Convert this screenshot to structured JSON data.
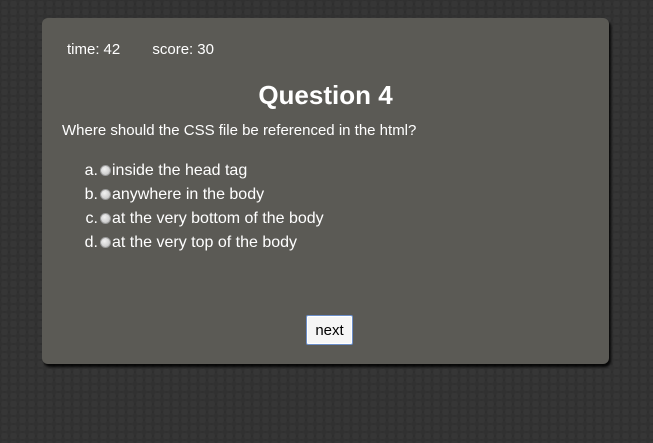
{
  "stats": {
    "time_label": "time:",
    "time_value": "42",
    "score_label": "score:",
    "score_value": "30"
  },
  "quiz": {
    "title": "Question 4",
    "question": "Where should the CSS file be referenced in the html?",
    "answers": [
      {
        "letter": "a.",
        "text": "inside the head tag"
      },
      {
        "letter": "b.",
        "text": "anywhere in the body"
      },
      {
        "letter": "c.",
        "text": "at the very bottom of the body"
      },
      {
        "letter": "d.",
        "text": "at the very top of the body"
      }
    ],
    "next_label": "next"
  },
  "colors": {
    "card_background": "#5b5a55",
    "page_background": "#2b2b2b",
    "text": "#ffffff",
    "button_border": "#6c8ec8"
  }
}
